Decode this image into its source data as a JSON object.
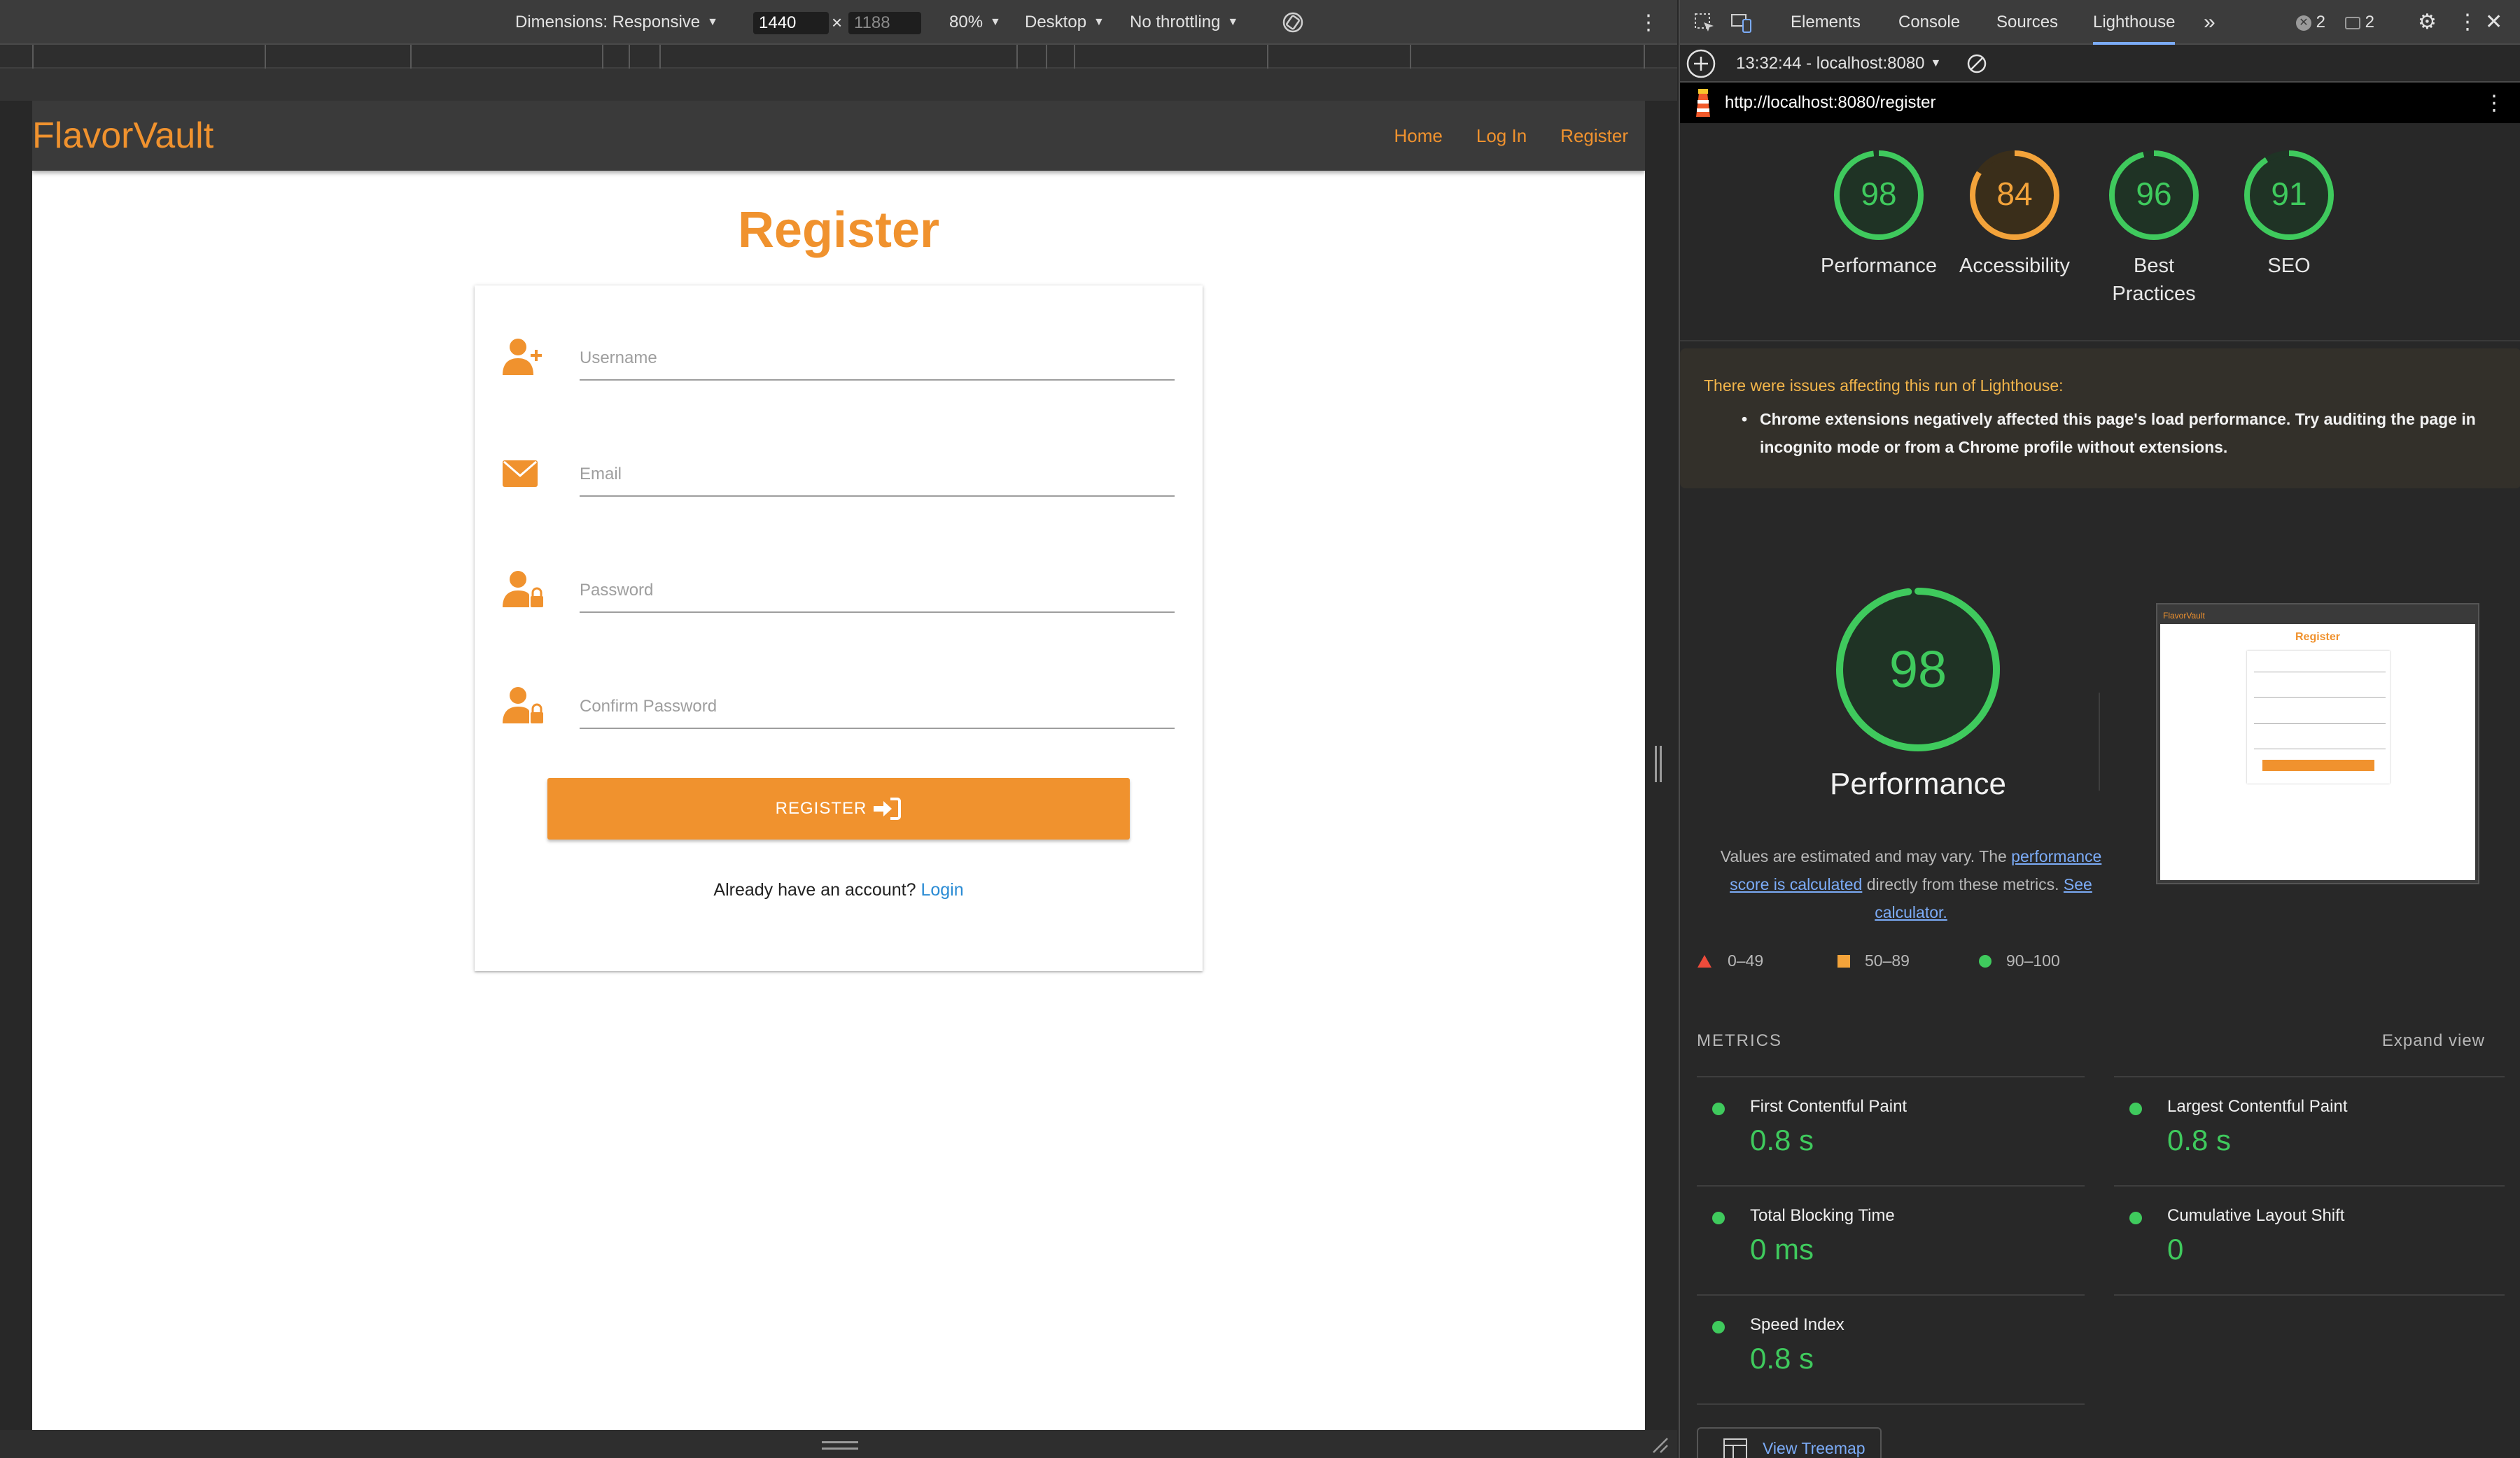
{
  "device_toolbar": {
    "dimensions_label": "Dimensions: Responsive",
    "width_value": "1440",
    "height_placeholder": "1188",
    "times_sign": "×",
    "zoom": "80%",
    "device_mode": "Desktop",
    "throttling": "No throttling"
  },
  "site": {
    "brand": "FlavorVault",
    "nav": [
      "Home",
      "Log In",
      "Register"
    ],
    "page_title": "Register",
    "fields": [
      {
        "placeholder": "Username",
        "icon": "user-plus-icon"
      },
      {
        "placeholder": "Email",
        "icon": "envelope-icon"
      },
      {
        "placeholder": "Password",
        "icon": "user-lock-icon"
      },
      {
        "placeholder": "Confirm Password",
        "icon": "user-lock-icon"
      }
    ],
    "register_button": "REGISTER",
    "account_prompt": "Already have an account?",
    "login_link": "Login",
    "accent_color": "#f0922e"
  },
  "devtools": {
    "tabs": [
      "Elements",
      "Console",
      "Sources",
      "Lighthouse"
    ],
    "active_tab": "Lighthouse",
    "error_count": "2",
    "message_count": "2",
    "report_label": "13:32:44 - localhost:8080",
    "url": "http://localhost:8080/register"
  },
  "lighthouse": {
    "scores": [
      {
        "label": "Performance",
        "value": 98,
        "status": "pass"
      },
      {
        "label": "Accessibility",
        "value": 84,
        "status": "average"
      },
      {
        "label": "Best Practices",
        "value": 96,
        "status": "pass"
      },
      {
        "label": "SEO",
        "value": 91,
        "status": "pass"
      }
    ],
    "warning_title": "There were issues affecting this run of Lighthouse:",
    "warning_text": "Chrome extensions negatively affected this page's load performance. Try auditing the page in incognito mode or from a Chrome profile without extensions.",
    "performance_big": {
      "value": 98,
      "title": "Performance"
    },
    "note_pre": "Values are estimated and may vary. The",
    "note_link1": "performance score is calculated",
    "note_mid": "directly from these metrics.",
    "note_link2": "See calculator.",
    "legend": [
      "0–49",
      "50–89",
      "90–100"
    ],
    "metrics_heading": "METRICS",
    "expand_view": "Expand view",
    "metrics": [
      {
        "name": "First Contentful Paint",
        "value": "0.8 s"
      },
      {
        "name": "Largest Contentful Paint",
        "value": "0.8 s"
      },
      {
        "name": "Total Blocking Time",
        "value": "0 ms"
      },
      {
        "name": "Cumulative Layout Shift",
        "value": "0"
      },
      {
        "name": "Speed Index",
        "value": "0.8 s"
      }
    ],
    "view_treemap": "View Treemap",
    "colors": {
      "pass": "#3fca5d",
      "average": "#f3a33a",
      "fail": "#ee4b3b"
    }
  }
}
